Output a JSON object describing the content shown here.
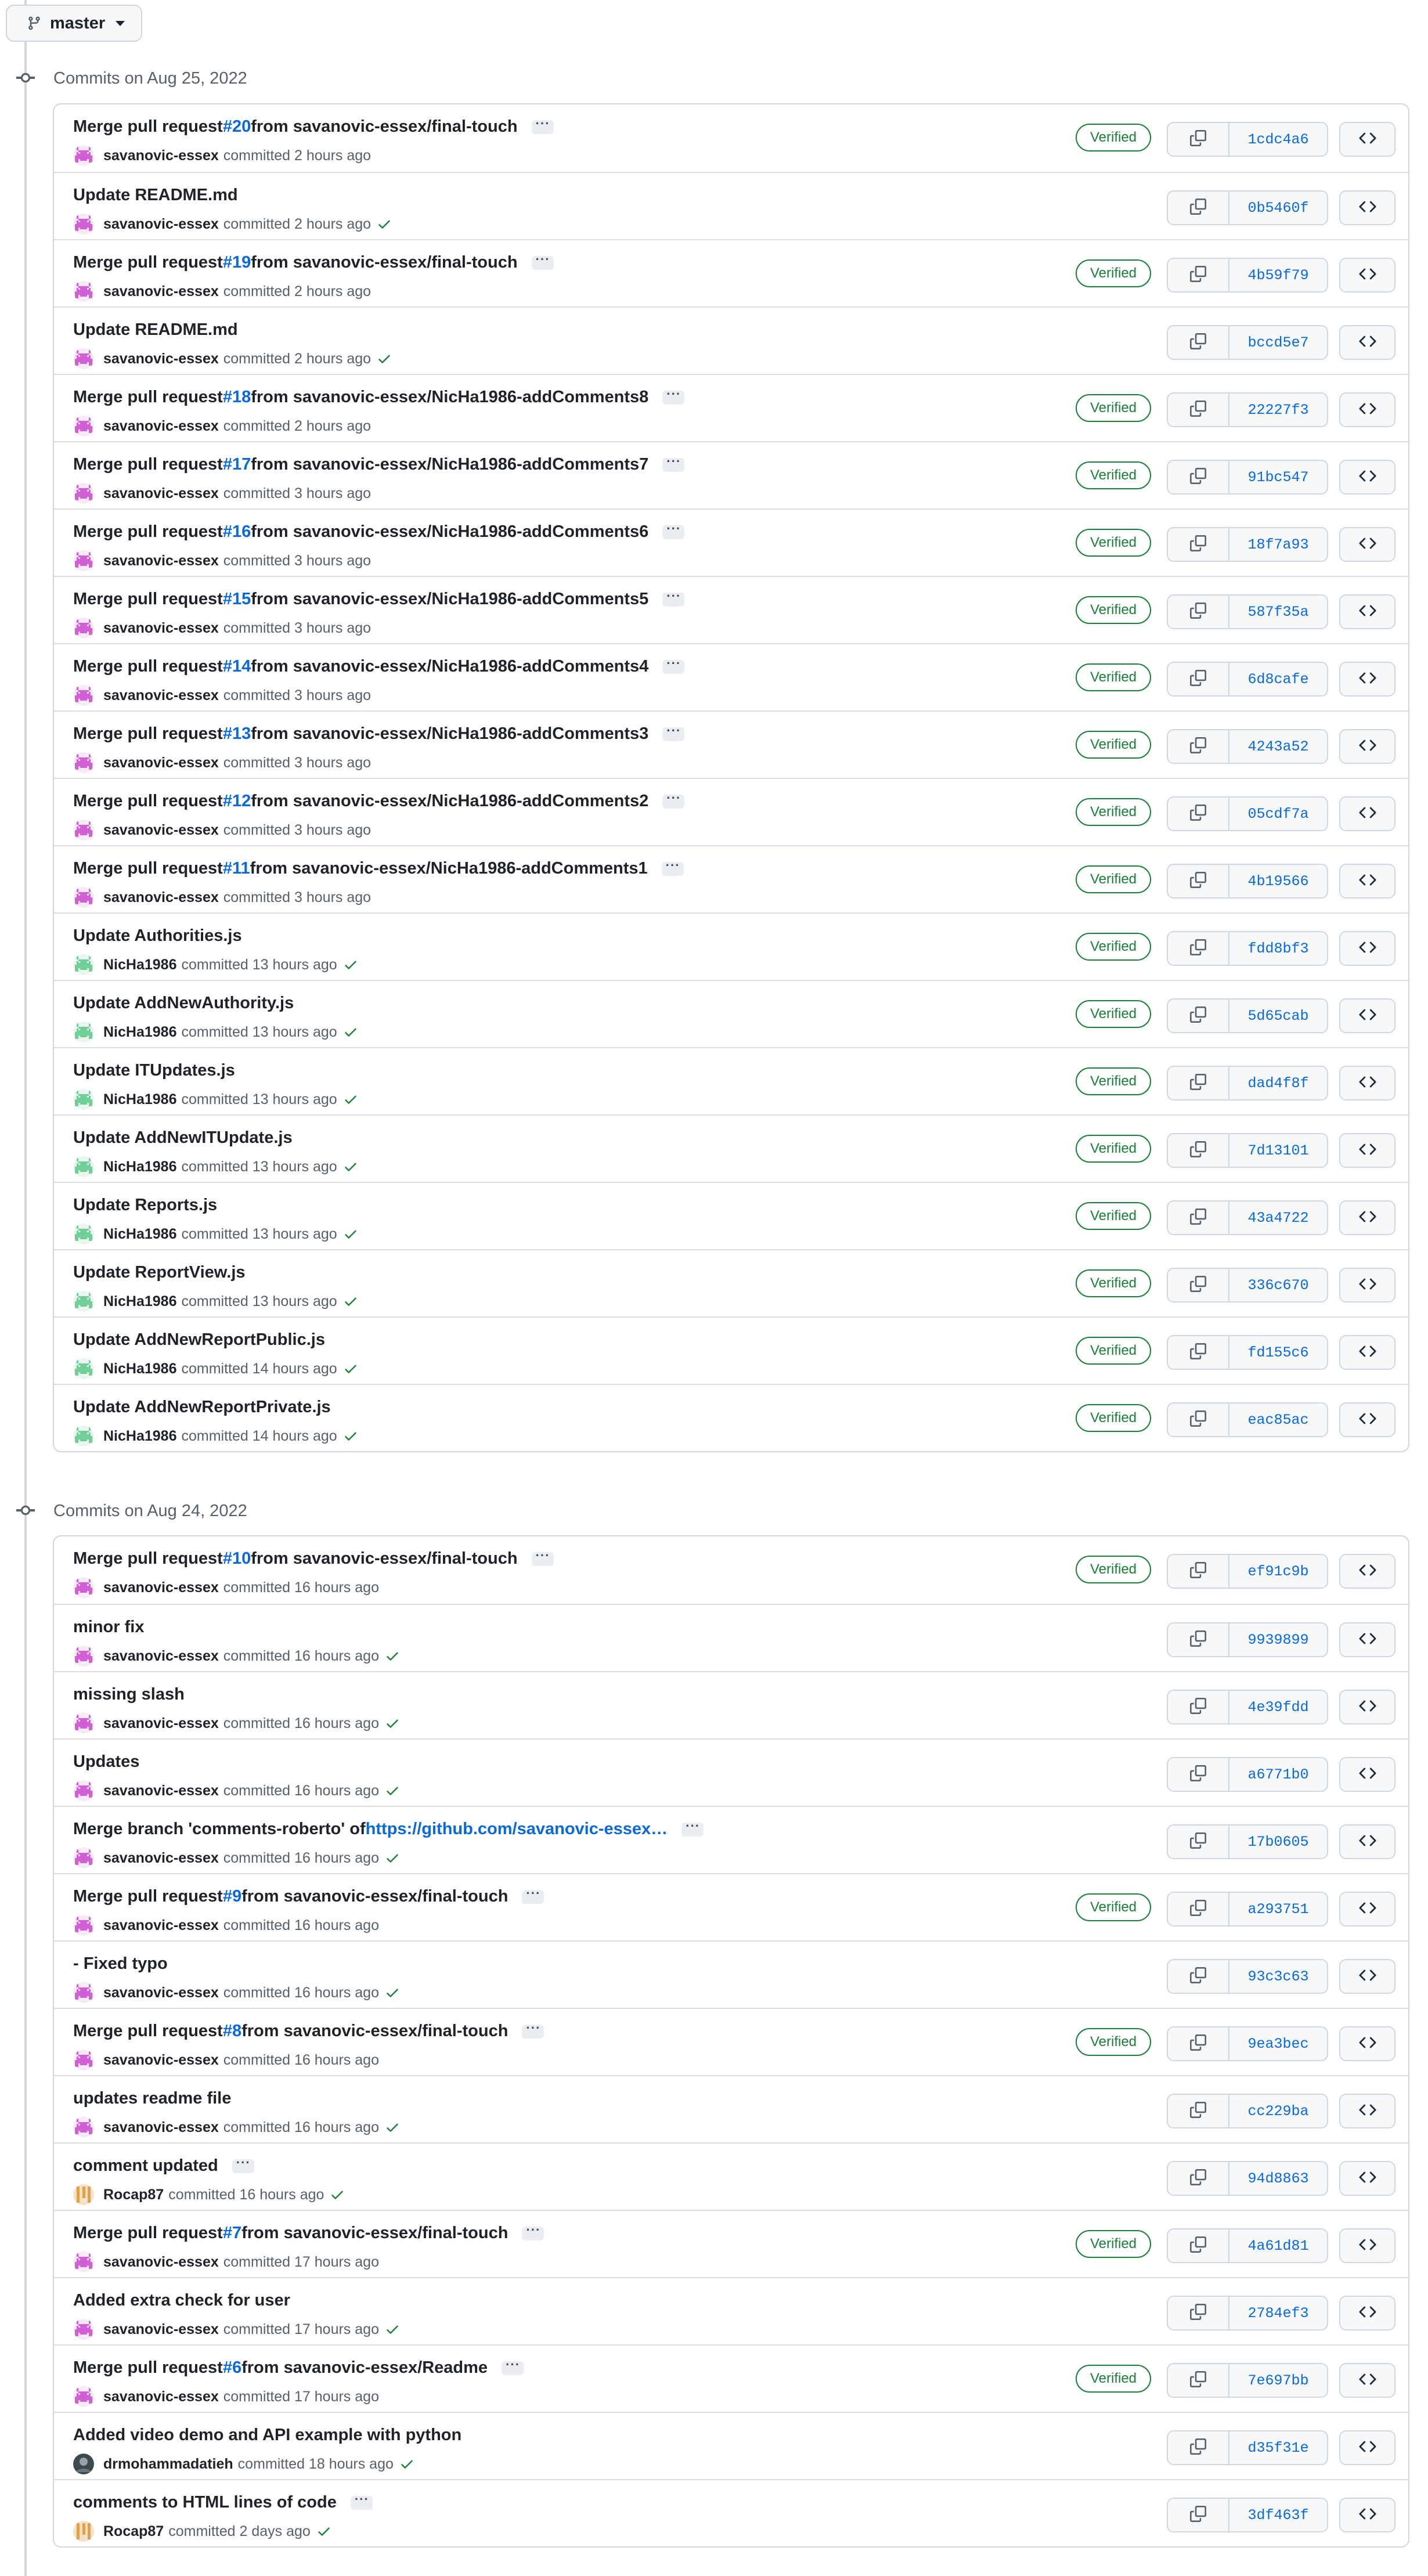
{
  "branch": {
    "name": "master"
  },
  "groups": [
    {
      "heading": "Commits on Aug 25, 2022",
      "commits": [
        {
          "title": "Merge pull request ",
          "pr": "#20",
          "rest": " from savanovic-essex/final-touch",
          "ellipsis": true,
          "author": "savanovic-essex",
          "time": "committed 2 hours ago",
          "check": false,
          "verified": true,
          "verified_label": "Verified",
          "sha": "1cdc4a6",
          "avatar": "invader-pink"
        },
        {
          "title": "Update README.md",
          "pr": "",
          "rest": "",
          "ellipsis": false,
          "author": "savanovic-essex",
          "time": "committed 2 hours ago",
          "check": true,
          "verified": false,
          "verified_label": "",
          "sha": "0b5460f",
          "avatar": "invader-pink"
        },
        {
          "title": "Merge pull request ",
          "pr": "#19",
          "rest": " from savanovic-essex/final-touch",
          "ellipsis": true,
          "author": "savanovic-essex",
          "time": "committed 2 hours ago",
          "check": false,
          "verified": true,
          "verified_label": "Verified",
          "sha": "4b59f79",
          "avatar": "invader-pink"
        },
        {
          "title": "Update README.md",
          "pr": "",
          "rest": "",
          "ellipsis": false,
          "author": "savanovic-essex",
          "time": "committed 2 hours ago",
          "check": true,
          "verified": false,
          "verified_label": "",
          "sha": "bccd5e7",
          "avatar": "invader-pink"
        },
        {
          "title": "Merge pull request ",
          "pr": "#18",
          "rest": " from savanovic-essex/NicHa1986-addComments8",
          "ellipsis": true,
          "author": "savanovic-essex",
          "time": "committed 2 hours ago",
          "check": false,
          "verified": true,
          "verified_label": "Verified",
          "sha": "22227f3",
          "avatar": "invader-pink"
        },
        {
          "title": "Merge pull request ",
          "pr": "#17",
          "rest": " from savanovic-essex/NicHa1986-addComments7",
          "ellipsis": true,
          "author": "savanovic-essex",
          "time": "committed 3 hours ago",
          "check": false,
          "verified": true,
          "verified_label": "Verified",
          "sha": "91bc547",
          "avatar": "invader-pink"
        },
        {
          "title": "Merge pull request ",
          "pr": "#16",
          "rest": " from savanovic-essex/NicHa1986-addComments6",
          "ellipsis": true,
          "author": "savanovic-essex",
          "time": "committed 3 hours ago",
          "check": false,
          "verified": true,
          "verified_label": "Verified",
          "sha": "18f7a93",
          "avatar": "invader-pink"
        },
        {
          "title": "Merge pull request ",
          "pr": "#15",
          "rest": " from savanovic-essex/NicHa1986-addComments5",
          "ellipsis": true,
          "author": "savanovic-essex",
          "time": "committed 3 hours ago",
          "check": false,
          "verified": true,
          "verified_label": "Verified",
          "sha": "587f35a",
          "avatar": "invader-pink"
        },
        {
          "title": "Merge pull request ",
          "pr": "#14",
          "rest": " from savanovic-essex/NicHa1986-addComments4",
          "ellipsis": true,
          "author": "savanovic-essex",
          "time": "committed 3 hours ago",
          "check": false,
          "verified": true,
          "verified_label": "Verified",
          "sha": "6d8cafe",
          "avatar": "invader-pink"
        },
        {
          "title": "Merge pull request ",
          "pr": "#13",
          "rest": " from savanovic-essex/NicHa1986-addComments3",
          "ellipsis": true,
          "author": "savanovic-essex",
          "time": "committed 3 hours ago",
          "check": false,
          "verified": true,
          "verified_label": "Verified",
          "sha": "4243a52",
          "avatar": "invader-pink"
        },
        {
          "title": "Merge pull request ",
          "pr": "#12",
          "rest": " from savanovic-essex/NicHa1986-addComments2",
          "ellipsis": true,
          "author": "savanovic-essex",
          "time": "committed 3 hours ago",
          "check": false,
          "verified": true,
          "verified_label": "Verified",
          "sha": "05cdf7a",
          "avatar": "invader-pink"
        },
        {
          "title": "Merge pull request ",
          "pr": "#11",
          "rest": " from savanovic-essex/NicHa1986-addComments1",
          "ellipsis": true,
          "author": "savanovic-essex",
          "time": "committed 3 hours ago",
          "check": false,
          "verified": true,
          "verified_label": "Verified",
          "sha": "4b19566",
          "avatar": "invader-pink"
        },
        {
          "title": "Update Authorities.js",
          "pr": "",
          "rest": "",
          "ellipsis": false,
          "author": "NicHa1986",
          "time": "committed 13 hours ago",
          "check": true,
          "verified": true,
          "verified_label": "Verified",
          "sha": "fdd8bf3",
          "avatar": "invader-green"
        },
        {
          "title": "Update AddNewAuthority.js",
          "pr": "",
          "rest": "",
          "ellipsis": false,
          "author": "NicHa1986",
          "time": "committed 13 hours ago",
          "check": true,
          "verified": true,
          "verified_label": "Verified",
          "sha": "5d65cab",
          "avatar": "invader-green"
        },
        {
          "title": "Update ITUpdates.js",
          "pr": "",
          "rest": "",
          "ellipsis": false,
          "author": "NicHa1986",
          "time": "committed 13 hours ago",
          "check": true,
          "verified": true,
          "verified_label": "Verified",
          "sha": "dad4f8f",
          "avatar": "invader-green"
        },
        {
          "title": "Update AddNewITUpdate.js",
          "pr": "",
          "rest": "",
          "ellipsis": false,
          "author": "NicHa1986",
          "time": "committed 13 hours ago",
          "check": true,
          "verified": true,
          "verified_label": "Verified",
          "sha": "7d13101",
          "avatar": "invader-green"
        },
        {
          "title": "Update Reports.js",
          "pr": "",
          "rest": "",
          "ellipsis": false,
          "author": "NicHa1986",
          "time": "committed 13 hours ago",
          "check": true,
          "verified": true,
          "verified_label": "Verified",
          "sha": "43a4722",
          "avatar": "invader-green"
        },
        {
          "title": "Update ReportView.js",
          "pr": "",
          "rest": "",
          "ellipsis": false,
          "author": "NicHa1986",
          "time": "committed 13 hours ago",
          "check": true,
          "verified": true,
          "verified_label": "Verified",
          "sha": "336c670",
          "avatar": "invader-green"
        },
        {
          "title": "Update AddNewReportPublic.js",
          "pr": "",
          "rest": "",
          "ellipsis": false,
          "author": "NicHa1986",
          "time": "committed 14 hours ago",
          "check": true,
          "verified": true,
          "verified_label": "Verified",
          "sha": "fd155c6",
          "avatar": "invader-green"
        },
        {
          "title": "Update AddNewReportPrivate.js",
          "pr": "",
          "rest": "",
          "ellipsis": false,
          "author": "NicHa1986",
          "time": "committed 14 hours ago",
          "check": true,
          "verified": true,
          "verified_label": "Verified",
          "sha": "eac85ac",
          "avatar": "invader-green"
        }
      ]
    },
    {
      "heading": "Commits on Aug 24, 2022",
      "commits": [
        {
          "title": "Merge pull request ",
          "pr": "#10",
          "rest": " from savanovic-essex/final-touch",
          "ellipsis": true,
          "author": "savanovic-essex",
          "time": "committed 16 hours ago",
          "check": false,
          "verified": true,
          "verified_label": "Verified",
          "sha": "ef91c9b",
          "avatar": "invader-pink"
        },
        {
          "title": "minor fix",
          "pr": "",
          "rest": "",
          "ellipsis": false,
          "author": "savanovic-essex",
          "time": "committed 16 hours ago",
          "check": true,
          "verified": false,
          "verified_label": "",
          "sha": "9939899",
          "avatar": "invader-pink"
        },
        {
          "title": "missing slash",
          "pr": "",
          "rest": "",
          "ellipsis": false,
          "author": "savanovic-essex",
          "time": "committed 16 hours ago",
          "check": true,
          "verified": false,
          "verified_label": "",
          "sha": "4e39fdd",
          "avatar": "invader-pink"
        },
        {
          "title": "Updates",
          "pr": "",
          "rest": "",
          "ellipsis": false,
          "author": "savanovic-essex",
          "time": "committed 16 hours ago",
          "check": true,
          "verified": false,
          "verified_label": "",
          "sha": "a6771b0",
          "avatar": "invader-pink"
        },
        {
          "title": "Merge branch 'comments-roberto' of ",
          "pr": "",
          "link": "https://github.com/savanovic-essex…",
          "rest": "",
          "ellipsis": true,
          "author": "savanovic-essex",
          "time": "committed 16 hours ago",
          "check": true,
          "verified": false,
          "verified_label": "",
          "sha": "17b0605",
          "avatar": "invader-pink"
        },
        {
          "title": "Merge pull request ",
          "pr": "#9",
          "rest": " from savanovic-essex/final-touch",
          "ellipsis": true,
          "author": "savanovic-essex",
          "time": "committed 16 hours ago",
          "check": false,
          "verified": true,
          "verified_label": "Verified",
          "sha": "a293751",
          "avatar": "invader-pink"
        },
        {
          "title": "- Fixed typo",
          "pr": "",
          "rest": "",
          "ellipsis": false,
          "author": "savanovic-essex",
          "time": "committed 16 hours ago",
          "check": true,
          "verified": false,
          "verified_label": "",
          "sha": "93c3c63",
          "avatar": "invader-pink"
        },
        {
          "title": "Merge pull request ",
          "pr": "#8",
          "rest": " from savanovic-essex/final-touch",
          "ellipsis": true,
          "author": "savanovic-essex",
          "time": "committed 16 hours ago",
          "check": false,
          "verified": true,
          "verified_label": "Verified",
          "sha": "9ea3bec",
          "avatar": "invader-pink"
        },
        {
          "title": "updates readme file",
          "pr": "",
          "rest": "",
          "ellipsis": false,
          "author": "savanovic-essex",
          "time": "committed 16 hours ago",
          "check": true,
          "verified": false,
          "verified_label": "",
          "sha": "cc229ba",
          "avatar": "invader-pink"
        },
        {
          "title": "comment updated",
          "pr": "",
          "rest": "",
          "ellipsis": true,
          "author": "Rocap87",
          "time": "committed 16 hours ago",
          "check": true,
          "verified": false,
          "verified_label": "",
          "sha": "94d8863",
          "avatar": "stripes-orange"
        },
        {
          "title": "Merge pull request ",
          "pr": "#7",
          "rest": " from savanovic-essex/final-touch",
          "ellipsis": true,
          "author": "savanovic-essex",
          "time": "committed 17 hours ago",
          "check": false,
          "verified": true,
          "verified_label": "Verified",
          "sha": "4a61d81",
          "avatar": "invader-pink"
        },
        {
          "title": "Added extra check for user",
          "pr": "",
          "rest": "",
          "ellipsis": false,
          "author": "savanovic-essex",
          "time": "committed 17 hours ago",
          "check": true,
          "verified": false,
          "verified_label": "",
          "sha": "2784ef3",
          "avatar": "invader-pink"
        },
        {
          "title": "Merge pull request ",
          "pr": "#6",
          "rest": " from savanovic-essex/Readme",
          "ellipsis": true,
          "author": "savanovic-essex",
          "time": "committed 17 hours ago",
          "check": false,
          "verified": true,
          "verified_label": "Verified",
          "sha": "7e697bb",
          "avatar": "invader-pink"
        },
        {
          "title": "Added video demo and API example with python",
          "pr": "",
          "rest": "",
          "ellipsis": false,
          "author": "drmohammadatieh",
          "time": "committed 18 hours ago",
          "check": true,
          "verified": false,
          "verified_label": "",
          "sha": "d35f31e",
          "avatar": "photo"
        },
        {
          "title": "comments to HTML lines of code",
          "pr": "",
          "rest": "",
          "ellipsis": true,
          "author": "Rocap87",
          "time": "committed 2 days ago",
          "check": true,
          "verified": false,
          "verified_label": "",
          "sha": "3df463f",
          "avatar": "stripes-orange"
        }
      ]
    }
  ],
  "colors": {
    "link": "#0969da",
    "verified": "#1a7f37",
    "check": "#1a7f37",
    "border": "#d0d7de"
  }
}
